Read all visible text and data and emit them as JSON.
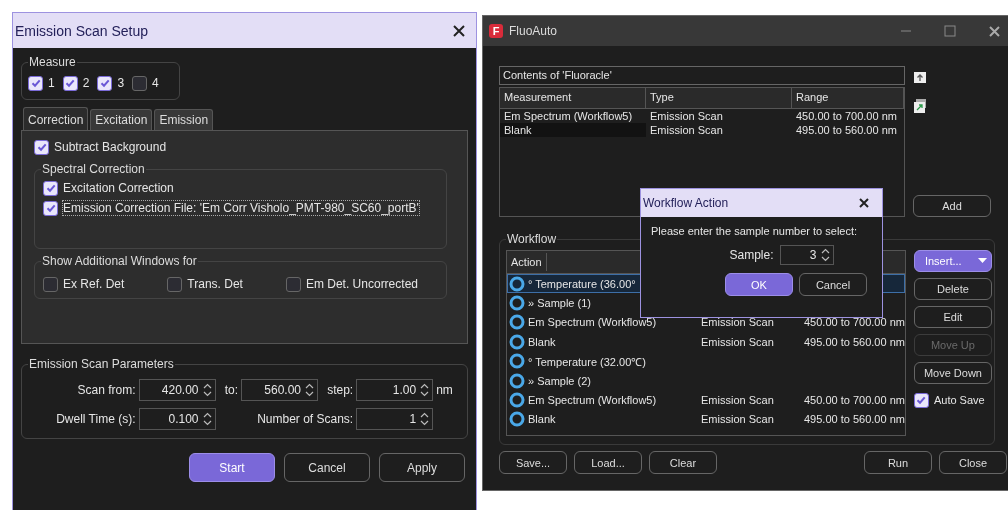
{
  "setup_window": {
    "title": "Emission Scan Setup",
    "measure": {
      "title": "Measure",
      "options": [
        {
          "label": "1",
          "checked": true
        },
        {
          "label": "2",
          "checked": true
        },
        {
          "label": "3",
          "checked": true
        },
        {
          "label": "4",
          "checked": false
        }
      ]
    },
    "tabs": [
      {
        "label": "Correction",
        "selected": true
      },
      {
        "label": "Excitation",
        "selected": false
      },
      {
        "label": "Emission",
        "selected": false
      }
    ],
    "subtract_background": {
      "label": "Subtract Background",
      "checked": true
    },
    "spectral_correction": {
      "title": "Spectral Correction",
      "options": [
        {
          "label": "Excitation Correction",
          "checked": true,
          "focused": false
        },
        {
          "label": "Emission Correction File: 'Em Corr Visholo_PMT-980_SC60_portB'",
          "checked": true,
          "focused": true
        }
      ]
    },
    "additional_windows": {
      "title": "Show Additional Windows for",
      "options": [
        {
          "label": "Ex Ref. Det",
          "checked": false
        },
        {
          "label": "Trans. Det",
          "checked": false
        },
        {
          "label": "Em Det. Uncorrected",
          "checked": false
        }
      ]
    },
    "parameters": {
      "title": "Emission Scan Parameters",
      "rows": [
        [
          {
            "label": "Scan from:",
            "value": "420.00"
          },
          {
            "label": "to:",
            "value": "560.00"
          },
          {
            "label": "step:",
            "value": "1.00",
            "unit": "nm"
          }
        ],
        [
          {
            "label": "Dwell Time (s):",
            "value": "0.100"
          },
          {
            "label": "Number of Scans:",
            "value": "1"
          }
        ]
      ]
    },
    "buttons": [
      {
        "label": "Start",
        "primary": true
      },
      {
        "label": "Cancel",
        "primary": false
      },
      {
        "label": "Apply",
        "primary": false
      }
    ]
  },
  "fluo_window": {
    "logo": "F",
    "title": "FluoAuto",
    "contents": {
      "title": "Contents of 'Fluoracle'",
      "columns": [
        "Measurement",
        "Type",
        "Range"
      ],
      "rows": [
        {
          "cells": [
            "Em Spectrum (Workflow5)",
            "Emission Scan",
            "450.00 to 700.00 nm"
          ],
          "selected": false
        },
        {
          "cells": [
            "Blank",
            "Emission Scan",
            "495.00 to 560.00 nm"
          ],
          "selected": true
        }
      ]
    },
    "add_button": "Add",
    "workflow": {
      "title": "Workflow",
      "columns": [
        "Action"
      ],
      "rows": [
        {
          "action": "° Temperature (36.00°",
          "selected": true
        },
        {
          "action": "» Sample (1)",
          "selected": false
        },
        {
          "action": "Em Spectrum (Workflow5)",
          "type": "Emission Scan",
          "range": "450.00 to 700.00 nm",
          "selected": false
        },
        {
          "action": "Blank",
          "type": "Emission Scan",
          "range": "495.00 to 560.00 nm",
          "selected": false
        },
        {
          "action": "° Temperature (32.00℃)",
          "selected": false
        },
        {
          "action": "» Sample (2)",
          "selected": false
        },
        {
          "action": "Em Spectrum (Workflow5)",
          "type": "Emission Scan",
          "range": "450.00 to 700.00 nm",
          "selected": false
        },
        {
          "action": "Blank",
          "type": "Emission Scan",
          "range": "495.00 to 560.00 nm",
          "selected": false
        }
      ]
    },
    "side_buttons": [
      {
        "label": "Insert...",
        "kind": "split",
        "disabled": false
      },
      {
        "label": "Delete",
        "kind": "plain",
        "disabled": false
      },
      {
        "label": "Edit",
        "kind": "plain",
        "disabled": false
      },
      {
        "label": "Move Up",
        "kind": "plain",
        "disabled": true
      },
      {
        "label": "Move Down",
        "kind": "plain",
        "disabled": false
      }
    ],
    "auto_save": {
      "label": "Auto Save",
      "checked": true
    },
    "left_buttons": [
      "Save...",
      "Load...",
      "Clear"
    ],
    "right_buttons": [
      "Run",
      "Close"
    ]
  },
  "dialog": {
    "title": "Workflow Action",
    "prompt": "Please enter the sample number to select:",
    "field": {
      "label": "Sample:",
      "value": "3"
    },
    "buttons": [
      {
        "label": "OK",
        "primary": true
      },
      {
        "label": "Cancel",
        "primary": false
      }
    ]
  }
}
